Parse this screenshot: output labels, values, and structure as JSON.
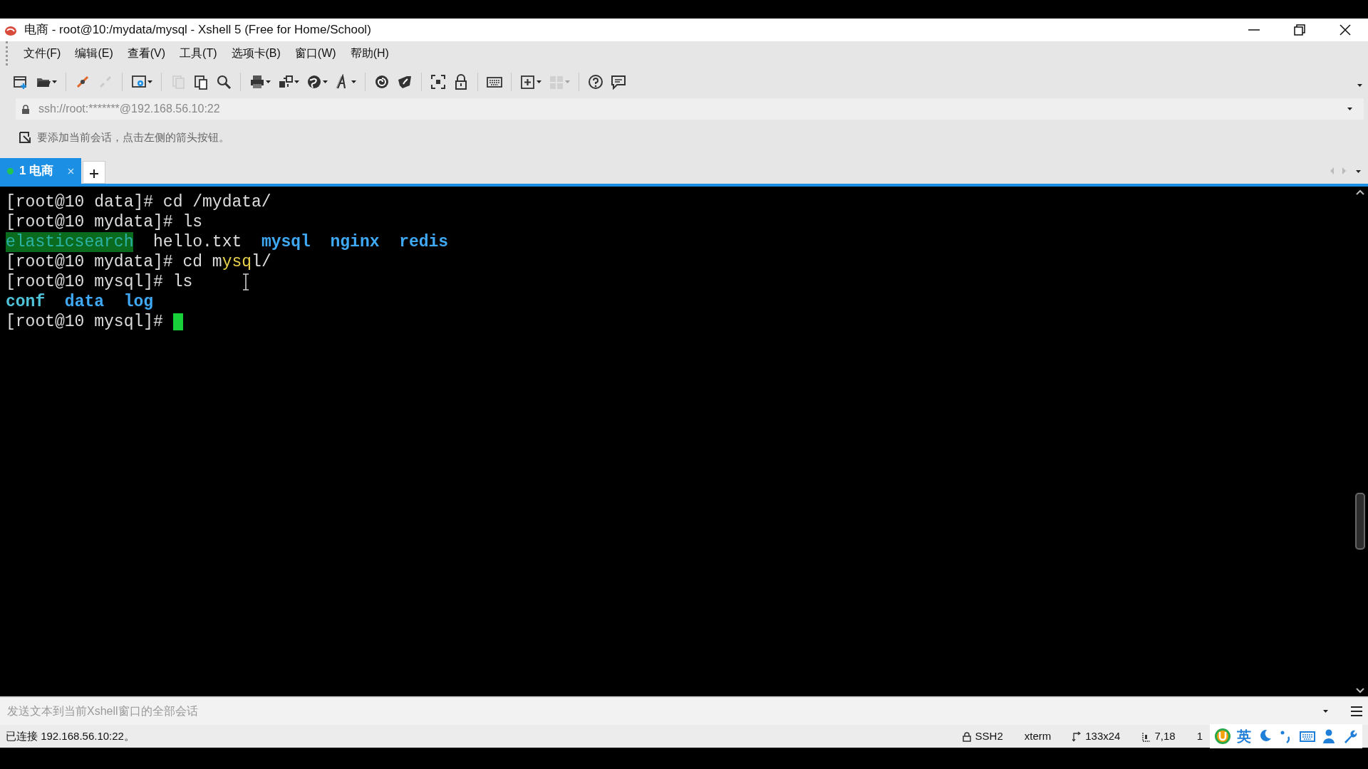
{
  "window": {
    "title": "电商 - root@10:/mydata/mysql - Xshell 5 (Free for Home/School)"
  },
  "menu": [
    "文件(F)",
    "编辑(E)",
    "查看(V)",
    "工具(T)",
    "选项卡(B)",
    "窗口(W)",
    "帮助(H)"
  ],
  "toolbar": [
    {
      "kind": "button",
      "disabled": false,
      "dropdown": false
    },
    {
      "kind": "button",
      "disabled": false,
      "dropdown": true
    },
    {
      "kind": "separator"
    },
    {
      "kind": "button",
      "disabled": false,
      "dropdown": false
    },
    {
      "kind": "button",
      "disabled": true,
      "dropdown": false
    },
    {
      "kind": "separator"
    },
    {
      "kind": "button",
      "disabled": false,
      "dropdown": true
    },
    {
      "kind": "separator"
    },
    {
      "kind": "button",
      "disabled": true,
      "dropdown": false
    },
    {
      "kind": "button",
      "disabled": false,
      "dropdown": false
    },
    {
      "kind": "button",
      "disabled": false,
      "dropdown": false
    },
    {
      "kind": "separator"
    },
    {
      "kind": "button",
      "disabled": false,
      "dropdown": true
    },
    {
      "kind": "button",
      "disabled": false,
      "dropdown": true
    },
    {
      "kind": "button",
      "disabled": false,
      "dropdown": true
    },
    {
      "kind": "button",
      "disabled": false,
      "dropdown": true
    },
    {
      "kind": "separator"
    },
    {
      "kind": "button",
      "disabled": false,
      "dropdown": false
    },
    {
      "kind": "button",
      "disabled": false,
      "dropdown": false
    },
    {
      "kind": "separator"
    },
    {
      "kind": "button",
      "disabled": false,
      "dropdown": false
    },
    {
      "kind": "button",
      "disabled": false,
      "dropdown": false
    },
    {
      "kind": "separator"
    },
    {
      "kind": "button",
      "disabled": false,
      "dropdown": false
    },
    {
      "kind": "separator"
    },
    {
      "kind": "button",
      "disabled": false,
      "dropdown": true
    },
    {
      "kind": "button",
      "disabled": true,
      "dropdown": true
    },
    {
      "kind": "separator"
    },
    {
      "kind": "button",
      "disabled": false,
      "dropdown": false
    },
    {
      "kind": "button",
      "disabled": false,
      "dropdown": false
    }
  ],
  "address": {
    "value": "ssh://root:*******@192.168.56.10:22"
  },
  "hint": "要添加当前会话，点击左侧的箭头按钮。",
  "tabs": [
    {
      "label": "1 电商",
      "selected": true,
      "connected": true
    }
  ],
  "terminal": {
    "lines": [
      {
        "segments": [
          {
            "kind": "text",
            "text": "[root@10 data]# cd /mydata/"
          }
        ],
        "cursor": false,
        "mouse_pointer": false
      },
      {
        "segments": [
          {
            "kind": "text",
            "text": "[root@10 mydata]# ls"
          }
        ],
        "cursor": false,
        "mouse_pointer": false
      },
      {
        "segments": [
          {
            "kind": "highlight",
            "text": "elasticsearch"
          },
          {
            "kind": "text",
            "text": "  hello.txt  "
          },
          {
            "kind": "dir",
            "text": "mysql  "
          },
          {
            "kind": "dir",
            "text": "nginx  "
          },
          {
            "kind": "dir",
            "text": "redis"
          }
        ],
        "cursor": false,
        "mouse_pointer": false
      },
      {
        "segments": [
          {
            "kind": "text",
            "text": "[root@10 mydata]# cd m"
          },
          {
            "kind": "yellow",
            "text": "ysq"
          },
          {
            "kind": "text",
            "text": "l/"
          }
        ],
        "cursor": false,
        "mouse_pointer": false
      },
      {
        "segments": [
          {
            "kind": "text",
            "text": "[root@10 mysql]# ls"
          }
        ],
        "cursor": false,
        "mouse_pointer": true
      },
      {
        "segments": [
          {
            "kind": "cyan",
            "text": "conf  "
          },
          {
            "kind": "dir",
            "text": "data  "
          },
          {
            "kind": "dir",
            "text": "log"
          }
        ],
        "cursor": false,
        "mouse_pointer": false
      },
      {
        "segments": [
          {
            "kind": "text",
            "text": "[root@10 mysql]# "
          }
        ],
        "cursor": true,
        "mouse_pointer": false
      }
    ]
  },
  "send_bar": {
    "placeholder": "发送文本到当前Xshell窗口的全部会话"
  },
  "status_bar": {
    "message": "已连接 192.168.56.10:22。",
    "items": [
      {
        "kind": "lock",
        "text": "SSH2"
      },
      {
        "kind": "plain",
        "text": "xterm"
      },
      {
        "kind": "size",
        "text": "133x24"
      },
      {
        "kind": "cursor",
        "text": "7,18"
      },
      {
        "kind": "plain",
        "text": "1"
      }
    ]
  },
  "ime": {
    "language": "英"
  }
}
